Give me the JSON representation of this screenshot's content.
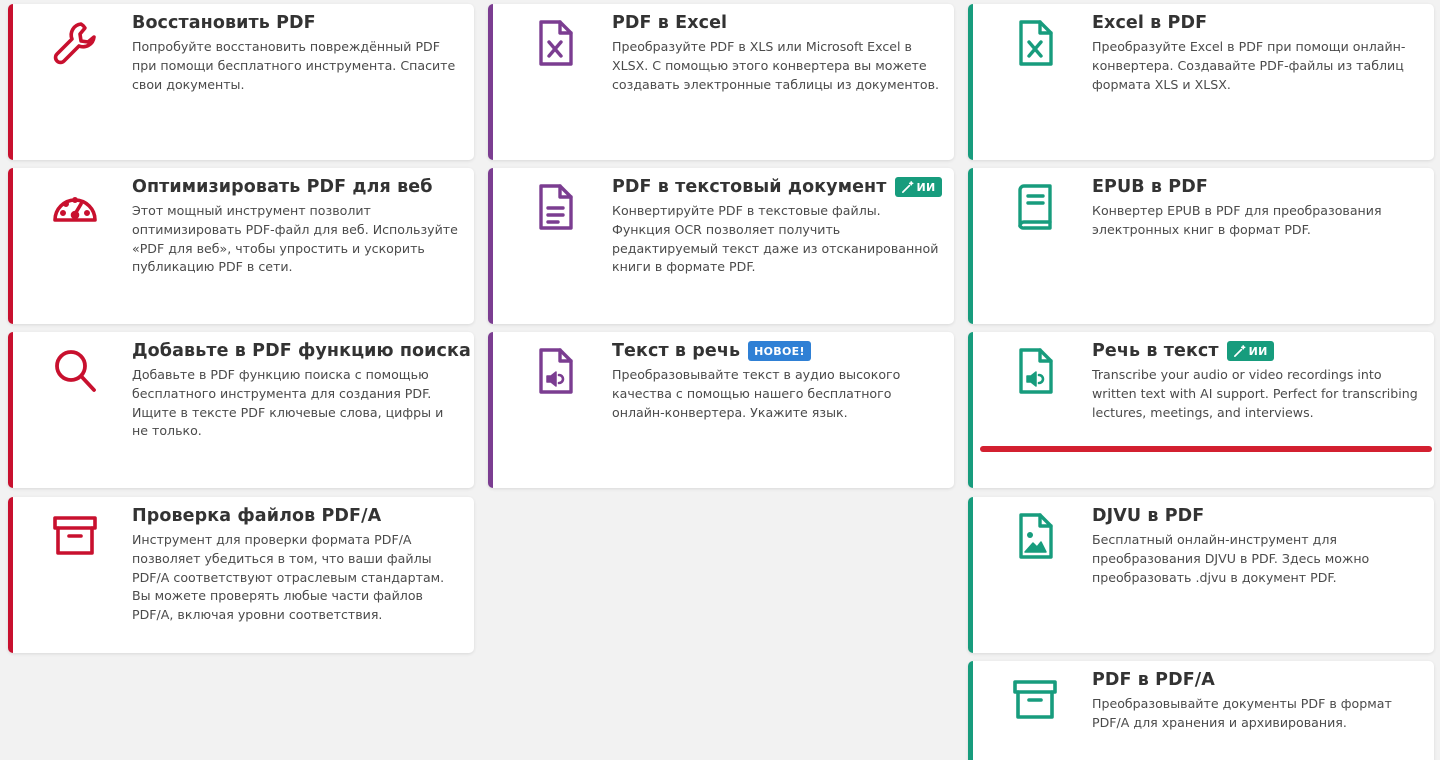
{
  "colors": {
    "red": "#c8102e",
    "purple": "#7b3d91",
    "green": "#179c7d",
    "badge_ai": "#179c7d",
    "badge_new": "#2f80d5",
    "underline_mark": "#d32030"
  },
  "cards": {
    "repair_pdf": {
      "title": "Восстановить PDF",
      "desc": "Попробуйте восстановить повреждённый PDF при помощи бесплатного инструмента. Спасите свои документы.",
      "icon": "wrench-icon"
    },
    "optimize_web": {
      "title": "Оптимизировать PDF для веб",
      "desc": "Этот мощный инструмент позволит оптимизировать PDF-файл для веб. Используйте «PDF для веб», чтобы упростить и ускорить публикацию PDF в сети.",
      "icon": "gauge-icon"
    },
    "add_search": {
      "title": "Добавьте в PDF функцию поиска",
      "desc": "Добавьте в PDF функцию поиска с помощью бесплатного инструмента для создания PDF. Ищите в тексте PDF ключевые слова, цифры и не только.",
      "icon": "search-icon"
    },
    "pdfa_check": {
      "title": "Проверка файлов PDF/A",
      "desc": "Инструмент для проверки формата PDF/A позволяет убедиться в том, что ваши файлы PDF/A соответствуют отраслевым стандартам. Вы можете проверять любые части файлов PDF/A, включая уровни соответствия.",
      "icon": "archive-box-icon"
    },
    "pdf_to_excel": {
      "title": "PDF в Excel",
      "desc": "Преобразуйте PDF в XLS или Microsoft Excel в XLSX. С помощью этого конвертера вы можете создавать электронные таблицы из документов.",
      "icon": "excel-file-icon"
    },
    "pdf_to_text": {
      "title": "PDF в текстовый документ",
      "badge": "ИИ",
      "desc": "Конвертируйте PDF в текстовые файлы. Функция OCR позволяет получить редактируемый текст даже из отсканированной книги в формате PDF.",
      "icon": "text-file-icon"
    },
    "text_to_speech": {
      "title": "Текст в речь",
      "badge": "НОВОЕ!",
      "desc": "Преобразовывайте текст в аудио высокого качества с помощью нашего бесплатного онлайн-конвертера. Укажите язык.",
      "icon": "audio-file-icon"
    },
    "excel_to_pdf": {
      "title": "Excel в PDF",
      "desc": "Преобразуйте Excel в PDF при помощи онлайн-конвертера. Создавайте PDF-файлы из таблиц формата XLS и XLSX.",
      "icon": "excel-file-icon"
    },
    "epub_to_pdf": {
      "title": "EPUB в PDF",
      "desc": "Конвертер EPUB в PDF для преобразования электронных книг в формат PDF.",
      "icon": "book-icon"
    },
    "speech_to_text": {
      "title": "Речь в текст",
      "badge": "ИИ",
      "desc": "Transcribe your audio or video recordings into written text with AI support. Perfect for transcribing lectures, meetings, and interviews.",
      "icon": "audio-file-icon"
    },
    "djvu_to_pdf": {
      "title": "DJVU в PDF",
      "desc": "Бесплатный онлайн-инструмент для преобразования DJVU в PDF. Здесь можно преобразовать .djvu в документ PDF.",
      "icon": "image-file-icon"
    },
    "pdf_to_pdfa": {
      "title": "PDF в PDF/A",
      "desc": "Преобразовывайте документы PDF в формат PDF/A для хранения и архивирования.",
      "icon": "archive-box-icon"
    }
  }
}
